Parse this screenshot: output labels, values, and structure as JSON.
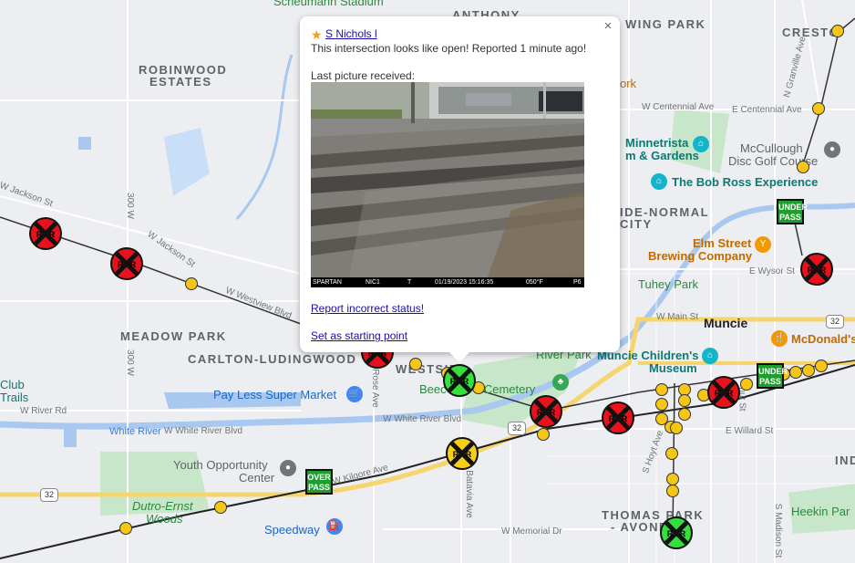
{
  "popup": {
    "title": "S Nichols l",
    "message": "This intersection looks like open! Reported 1 minute ago!",
    "picture_label": "Last picture received:",
    "report_link": "Report incorrect status!",
    "start_link": "Set as starting point",
    "close_glyph": "×",
    "star_glyph": "★",
    "photo_stamp": {
      "camera": "SPARTAN",
      "cam_id": "NIC1",
      "flag": "T",
      "timestamp": "01/19/2023 15:16:35",
      "temperature": "050°F",
      "frame": "P6"
    }
  },
  "map_labels": {
    "schoenmann_stadium": "Scheumann Stadium",
    "anthony": "ANTHONY",
    "wing_park": "WING PARK",
    "creston": "CRESTO",
    "robinwood": "ROBINWOOD",
    "estates": "ESTATES",
    "meadow_park": "MEADOW PARK",
    "carlton": "CARLTON-LUDINGWOOD",
    "westside": "WESTSID",
    "pay_less": "Pay Less Super Market",
    "white_river": "White River",
    "w_river_rd": "W River Rd",
    "club_trails_1": "Club",
    "club_trails_2": "Trails",
    "youth_opportunity_1": "Youth Opportunity",
    "youth_opportunity_2": "Center",
    "dutro_ernst_1": "Dutro-Ernst",
    "dutro_ernst_2": "Woods",
    "speedway": "Speedway",
    "beech_grove": "Beec",
    "cemetery": "e Cemetery",
    "minnetrista_1": "Minnetrista",
    "minnetrista_2": "m & Gardens",
    "bob_ross": "The Bob Ross Experience",
    "mccullough_1": "McCullough",
    "mccullough_2": "Disc Golf Course",
    "normal_city_1": "IDE-NORMAL",
    "normal_city_2": "CITY",
    "elm_street_1": "Elm Street",
    "elm_street_2": "Brewing Company",
    "tuhey_park": "Tuhey Park",
    "muncie": "Muncie",
    "river_park": "River Park",
    "childrens_museum_1": "Muncie Children's",
    "childrens_museum_2": "Museum",
    "mcdonalds": "McDonald's",
    "heekin_park": "Heekin Par",
    "thomas_park_1": "THOMAS PARK",
    "thomas_park_2": "- AVONDA",
    "ind": "IND",
    "york": "ork",
    "w_main_st": "W Main St",
    "w_centennial": "W Centennial Ave",
    "e_centennial": "E Centennial Ave",
    "e_wysor": "E Wysor St",
    "e_willard": "E Willard St",
    "w_jackson_1": "W Jackson St",
    "w_jackson_2": "W Jackson St",
    "w_westview": "W Westview Blvd",
    "w_white_river_1": "W White River Blvd",
    "w_white_river_2": "W White River Blvd",
    "w_kilgore": "W Kilgore Ave",
    "w_memorial": "W Memorial Dr",
    "batavia": "Batavia Ave",
    "s_hoyt": "S Hoyt Ave",
    "s_madison": "S Madison St",
    "n_granville": "N Granville Ave",
    "rose_ave": "Rose Ave",
    "300w_1": "300 W",
    "300w_2": "300 W",
    "route_32_a": "32",
    "route_32_b": "32",
    "route_32_c": "32",
    "nut_st": "nut St"
  },
  "signs": {
    "underpass": "UNDER",
    "pass": "PASS",
    "overpass": "OVER"
  },
  "rr_letter": "R",
  "colors": {
    "closed": "#e8121c",
    "open": "#36e03c",
    "caution": "#f6cf16",
    "sign": "#1e9e2e",
    "map_bg": "#eceef1",
    "water": "#a8c8f0",
    "park": "#c8e6c9"
  }
}
